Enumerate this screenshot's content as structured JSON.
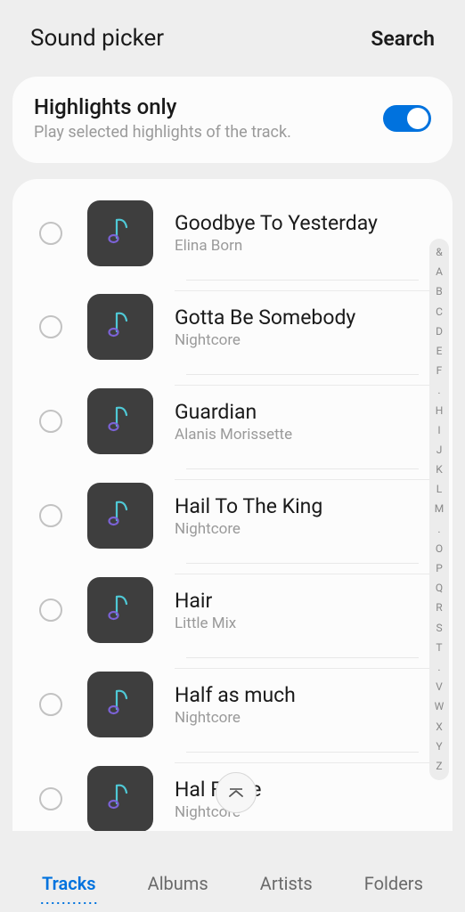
{
  "header": {
    "title": "Sound picker",
    "search": "Search"
  },
  "highlights": {
    "title": "Highlights only",
    "subtitle": "Play selected highlights of the track.",
    "enabled": true
  },
  "tracks": [
    {
      "title": "Goodbye To Yesterday",
      "artist": "Elina Born"
    },
    {
      "title": "Gotta Be Somebody",
      "artist": "Nightcore"
    },
    {
      "title": "Guardian",
      "artist": "Alanis Morissette"
    },
    {
      "title": "Hail To The King",
      "artist": "Nightcore"
    },
    {
      "title": "Hair",
      "artist": "Little Mix"
    },
    {
      "title": "Half as much",
      "artist": "Nightcore"
    },
    {
      "title": "Hal        Fame",
      "artist": "Nightcore"
    }
  ],
  "alpha_index": [
    "&",
    "A",
    "B",
    "C",
    "D",
    "E",
    "F",
    ".",
    "H",
    "I",
    "J",
    "K",
    "L",
    "M",
    ".",
    "O",
    "P",
    "Q",
    "R",
    "S",
    "T",
    ".",
    "V",
    "W",
    "X",
    "Y",
    "Z"
  ],
  "nav": {
    "items": [
      "Tracks",
      "Albums",
      "Artists",
      "Folders"
    ],
    "active": 0
  }
}
